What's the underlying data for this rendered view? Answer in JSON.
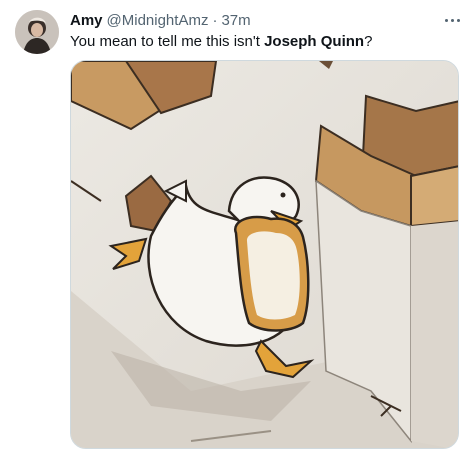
{
  "tweet": {
    "author": {
      "display_name": "Amy",
      "handle": "@MidnightAmz",
      "separator": "·",
      "timestamp": "37m"
    },
    "text": {
      "before": "You mean to tell me this isn't ",
      "bold": "Joseph Quinn",
      "after": "?"
    },
    "media": {
      "description_icon": "duck-with-bread-illustration"
    }
  },
  "colors": {
    "text_primary": "#0f1419",
    "text_secondary": "#536471",
    "border": "#cfd9de"
  }
}
